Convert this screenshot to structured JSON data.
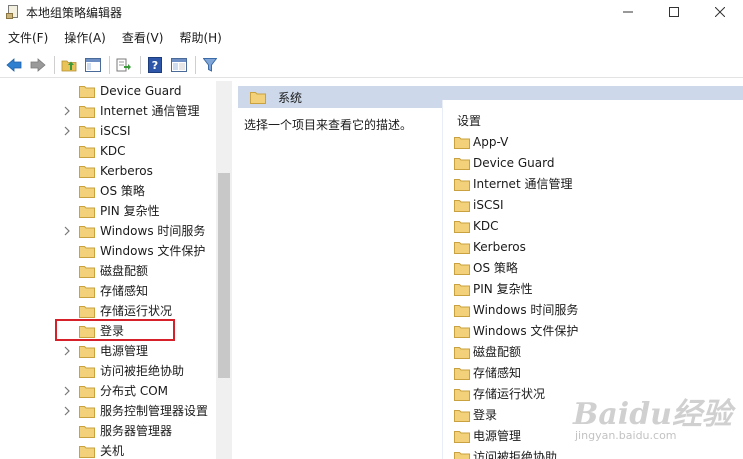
{
  "window": {
    "title": "本地组策略编辑器",
    "controls": [
      "minimize-icon",
      "maximize-icon",
      "close-icon"
    ]
  },
  "menu": {
    "items": [
      "文件(F)",
      "操作(A)",
      "查看(V)",
      "帮助(H)"
    ]
  },
  "toolbar": {
    "buttons": [
      "back-arrow-icon",
      "forward-arrow-icon",
      "up-folder-icon",
      "show-hide-tree-icon",
      "export-list-icon",
      "help-icon",
      "properties-icon",
      "filter-icon"
    ]
  },
  "tree": {
    "items": [
      {
        "label": "Device Guard",
        "expandable": false
      },
      {
        "label": "Internet 通信管理",
        "expandable": true
      },
      {
        "label": "iSCSI",
        "expandable": true
      },
      {
        "label": "KDC",
        "expandable": false
      },
      {
        "label": "Kerberos",
        "expandable": false
      },
      {
        "label": "OS 策略",
        "expandable": false
      },
      {
        "label": "PIN 复杂性",
        "expandable": false
      },
      {
        "label": "Windows 时间服务",
        "expandable": true
      },
      {
        "label": "Windows 文件保护",
        "expandable": false
      },
      {
        "label": "磁盘配额",
        "expandable": false
      },
      {
        "label": "存储感知",
        "expandable": false
      },
      {
        "label": "存储运行状况",
        "expandable": false
      },
      {
        "label": "登录",
        "expandable": false
      },
      {
        "label": "电源管理",
        "expandable": true
      },
      {
        "label": "访问被拒绝协助",
        "expandable": false
      },
      {
        "label": "分布式 COM",
        "expandable": true
      },
      {
        "label": "服务控制管理器设置",
        "expandable": true
      },
      {
        "label": "服务器管理器",
        "expandable": false
      },
      {
        "label": "关机",
        "expandable": false
      }
    ],
    "highlighted": "登录"
  },
  "right_pane": {
    "header_title": "系统",
    "description": "选择一个项目来查看它的描述。",
    "column_header": "设置",
    "items": [
      "App-V",
      "Device Guard",
      "Internet 通信管理",
      "iSCSI",
      "KDC",
      "Kerberos",
      "OS 策略",
      "PIN 复杂性",
      "Windows 时间服务",
      "Windows 文件保护",
      "磁盘配额",
      "存储感知",
      "存储运行状况",
      "登录",
      "电源管理",
      "访问被拒绝协助"
    ]
  },
  "watermark": {
    "text": "Baidu经验",
    "sub": "jingyan.baidu.com"
  },
  "colors": {
    "highlight_box": "#d6212a",
    "header_bg": "#cdd9ea",
    "folder_fill": "#f2d17a",
    "folder_edge": "#c9a23f"
  }
}
